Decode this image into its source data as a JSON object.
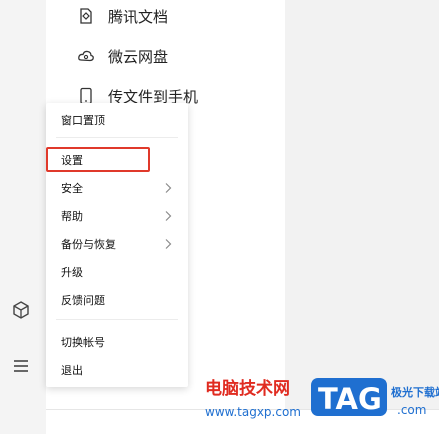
{
  "apps": [
    {
      "label": "腾讯文档",
      "icon": "tencent-docs-icon"
    },
    {
      "label": "微云网盘",
      "icon": "weiyun-cloud-icon"
    },
    {
      "label": "传文件到手机",
      "icon": "phone-transfer-icon"
    }
  ],
  "sidebar": {
    "icons": [
      "cube-app-icon",
      "hamburger-menu-icon"
    ]
  },
  "menu": {
    "items": [
      {
        "label": "窗口置顶",
        "submenu": false
      },
      {
        "label": "设置",
        "submenu": false,
        "highlighted": true
      },
      {
        "label": "安全",
        "submenu": true
      },
      {
        "label": "帮助",
        "submenu": true
      },
      {
        "label": "备份与恢复",
        "submenu": true
      },
      {
        "label": "升级",
        "submenu": false
      },
      {
        "label": "反馈问题",
        "submenu": false
      },
      {
        "label": "切换帐号",
        "submenu": false
      },
      {
        "label": "退出",
        "submenu": false
      }
    ]
  },
  "colors": {
    "highlight_border": "#e0392b",
    "watermark_red": "#e02b20",
    "watermark_blue": "#1f6fd0"
  },
  "watermark": {
    "cn_text": "电脑技术网",
    "url": "www.tagxp.com",
    "tag": "TAG",
    "side_text": "极光下载站",
    "com": ".com"
  }
}
